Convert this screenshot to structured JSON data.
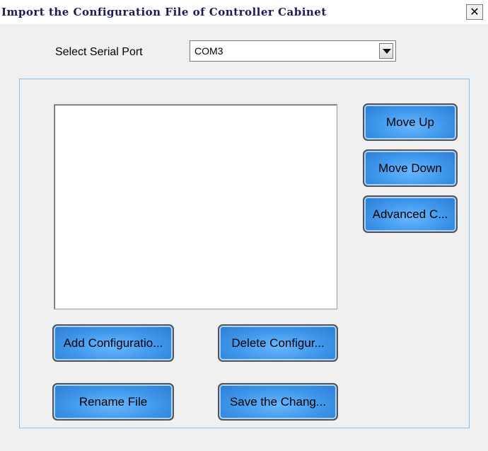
{
  "window": {
    "title": "Import the Configuration File of Controller Cabinet",
    "close_glyph": "✕"
  },
  "serial": {
    "label": "Select Serial Port",
    "value": "COM3"
  },
  "side_buttons": {
    "move_up": "Move Up",
    "move_down": "Move Down",
    "advanced": "Advanced C..."
  },
  "bottom_buttons": {
    "add": "Add Configuratio...",
    "delete": "Delete Configur...",
    "rename": "Rename File",
    "save": "Save the Chang..."
  },
  "icons": {
    "close": "close-icon",
    "dropdown": "chevron-down-icon"
  },
  "colors": {
    "button_blue": "#3d96ea",
    "panel_border": "#7fbef0",
    "title_text": "#1a1a5c"
  }
}
